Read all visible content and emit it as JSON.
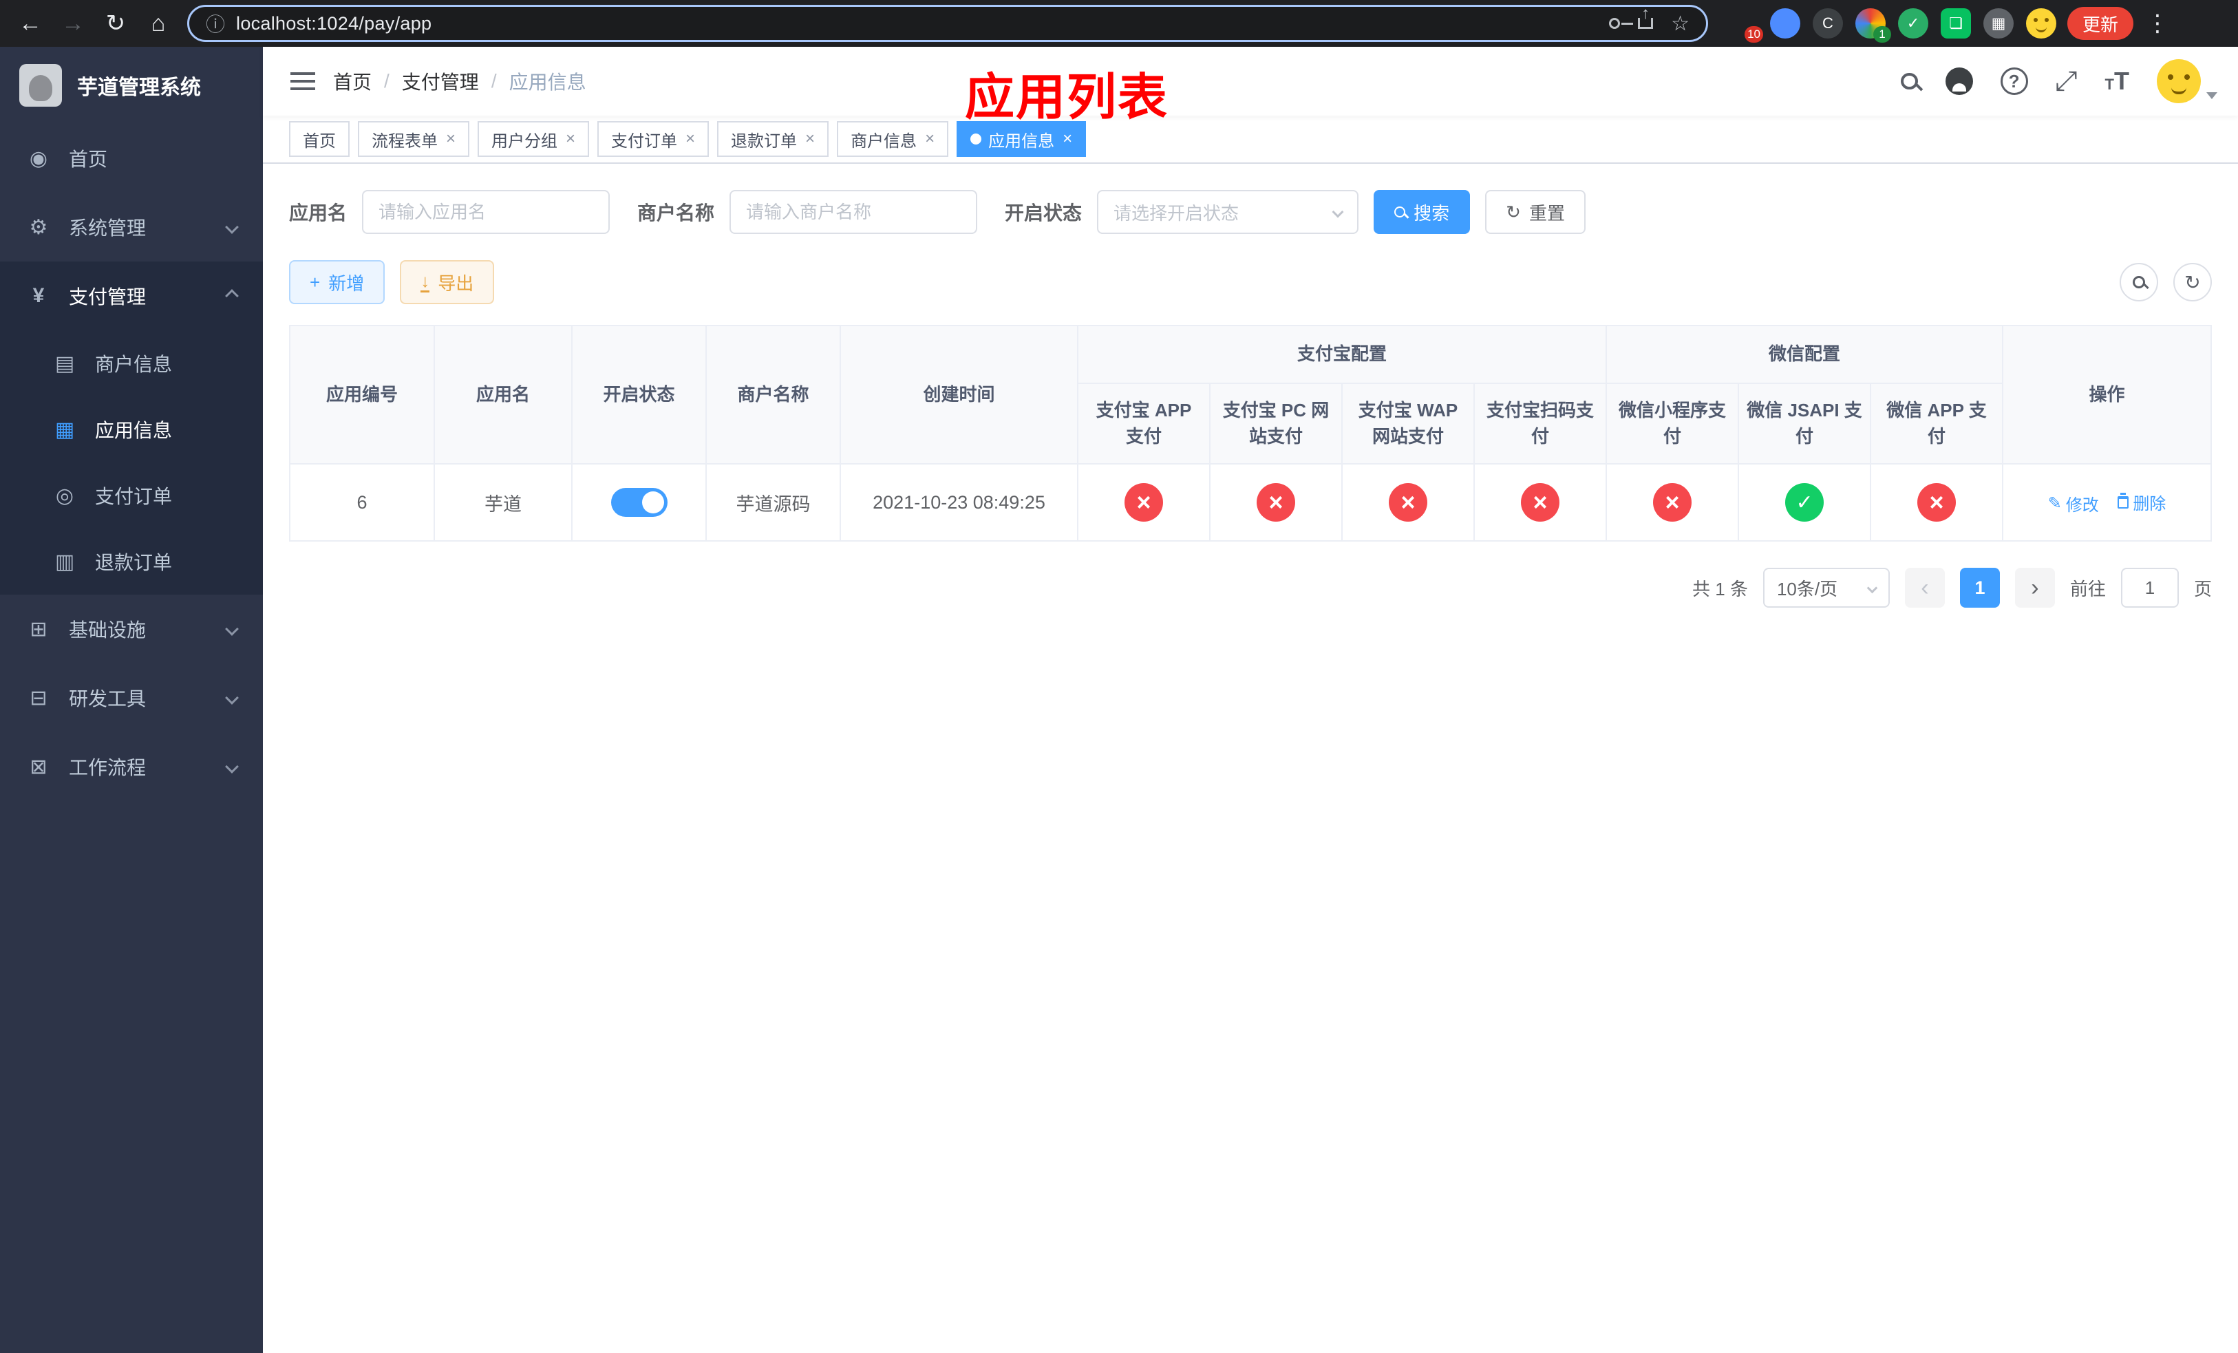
{
  "colors": {
    "accent": "#409eff",
    "danger": "#f5484d",
    "success": "#13ce66",
    "warning": "#e6a23c",
    "overlay_red": "#ff0000"
  },
  "browser": {
    "url": "localhost:1024/pay/app",
    "update_label": "更新",
    "ext_badge_apps": "10",
    "ext_badge_translate": "1"
  },
  "sidebar": {
    "title": "芋道管理系统",
    "menu": {
      "home": "首页",
      "system": "系统管理",
      "pay": "支付管理",
      "merchant": "商户信息",
      "app": "应用信息",
      "order": "支付订单",
      "refund": "退款订单",
      "infra": "基础设施",
      "dev": "研发工具",
      "workflow": "工作流程"
    }
  },
  "header": {
    "breadcrumb": [
      "首页",
      "支付管理",
      "应用信息"
    ],
    "separator": "/",
    "overlay_title": "应用列表"
  },
  "tabs": [
    "首页",
    "流程表单",
    "用户分组",
    "支付订单",
    "退款订单",
    "商户信息",
    "应用信息"
  ],
  "filters": {
    "app_name_label": "应用名",
    "app_name_placeholder": "请输入应用名",
    "merchant_label": "商户名称",
    "merchant_placeholder": "请输入商户名称",
    "status_label": "开启状态",
    "status_placeholder": "请选择开启状态",
    "search_label": "搜索",
    "reset_label": "重置"
  },
  "toolbar": {
    "add_label": "新增",
    "export_label": "导出"
  },
  "table": {
    "columns": {
      "id": "应用编号",
      "name": "应用名",
      "status": "开启状态",
      "merchant": "商户名称",
      "created": "创建时间",
      "alipay_group": "支付宝配置",
      "wechat_group": "微信配置",
      "actions": "操作",
      "alipay_sub": [
        "支付宝 APP 支付",
        "支付宝 PC 网站支付",
        "支付宝 WAP 网站支付",
        "支付宝扫码支付"
      ],
      "wechat_sub": [
        "微信小程序支付",
        "微信 JSAPI 支付",
        "微信 APP 支付"
      ]
    },
    "rows": [
      {
        "id": "6",
        "name": "芋道",
        "status": "on",
        "merchant": "芋道源码",
        "created": "2021-10-23 08:49:25",
        "alipay_states": [
          "off",
          "off",
          "off",
          "off"
        ],
        "wechat_states": [
          "off",
          "on",
          "off"
        ],
        "edit_label": "修改",
        "delete_label": "删除"
      }
    ]
  },
  "pagination": {
    "total_label": "共 1 条",
    "page_size": "10条/页",
    "current_page": "1",
    "goto_label": "前往",
    "goto_value": "1",
    "page_unit": "页"
  }
}
